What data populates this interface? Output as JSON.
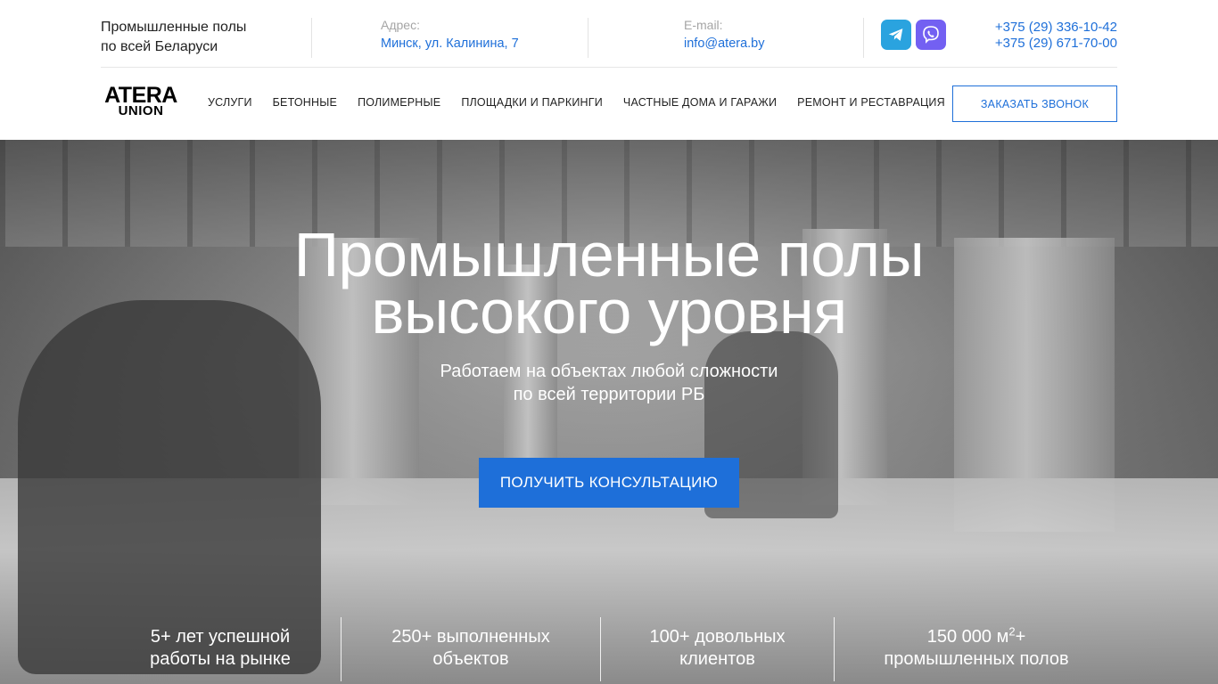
{
  "header": {
    "tagline_line1": "Промышленные полы",
    "tagline_line2": "по всей Беларуси",
    "address_label": "Адрес:",
    "address_value": "Минск, ул. Калинина, 7",
    "email_label": "E-mail:",
    "email_value": "info@atera.by",
    "messengers": [
      "telegram-icon",
      "viber-icon"
    ],
    "phones": [
      "+375 (29) 336-10-42",
      "+375 (29) 671-70-00"
    ]
  },
  "logo": {
    "top": "ATERA",
    "bottom": "UNION"
  },
  "nav": {
    "items": [
      "УСЛУГИ",
      "БЕТОННЫЕ",
      "ПОЛИМЕРНЫЕ",
      "ПЛОЩАДКИ И ПАРКИНГИ",
      "ЧАСТНЫЕ ДОМА И ГАРАЖИ",
      "РЕМОНТ И РЕСТАВРАЦИЯ"
    ],
    "callback_label": "ЗАКАЗАТЬ ЗВОНОК"
  },
  "hero": {
    "title_line1": "Промышленные полы",
    "title_line2": "высокого уровня",
    "subtitle_line1": "Работаем на объектах любой сложности",
    "subtitle_line2": "по всей территории РБ",
    "cta_label": "ПОЛУЧИТЬ КОНСУЛЬТАЦИЮ"
  },
  "stats": [
    {
      "line1": "5+ лет успешной",
      "line2": "работы на рынке"
    },
    {
      "line1": "250+ выполненных",
      "line2": "объектов"
    },
    {
      "line1": "100+ довольных",
      "line2": "клиентов"
    },
    {
      "line1_a": "150 000 м",
      "line1_sup": "2",
      "line1_b": "+",
      "line2": "промышленных полов"
    }
  ],
  "colors": {
    "accent": "#1e6fd9",
    "telegram": "#2aa3df",
    "viber": "#7360f2"
  }
}
